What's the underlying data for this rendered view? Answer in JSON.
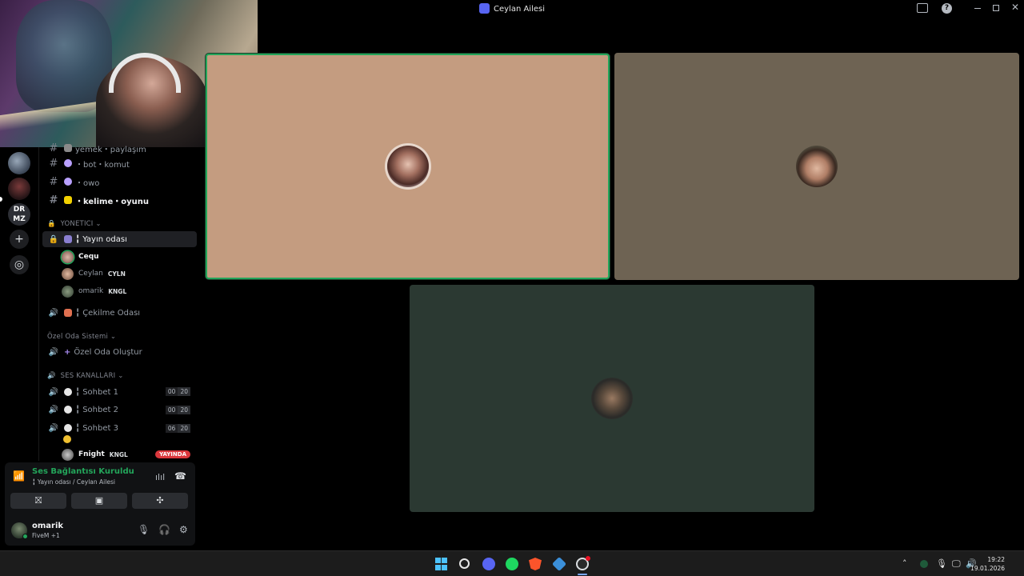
{
  "window": {
    "title": "Ceylan Ailesi"
  },
  "channels": {
    "text": [
      {
        "name": "yemek・paylaşım",
        "emoji_color": "#8a8a8a"
      },
      {
        "name": "・bot・komut",
        "emoji_color": "#b9a0ff"
      },
      {
        "name": "・owo",
        "emoji_color": "#b9a0ff"
      },
      {
        "name": "・kelime・oyunu",
        "emoji_color": "#f2d100"
      }
    ],
    "category_admin": "YONETICI",
    "stream_channel": "╏ Yayın odası",
    "stream_users": [
      {
        "name": "Cequ",
        "tag": ""
      },
      {
        "name": "Ceylan",
        "tag": "CYLN"
      },
      {
        "name": "omarik",
        "tag": "KNGL"
      }
    ],
    "cekilme": "╏ Çekilme Odası",
    "category_private": "Özel Oda Sistemi",
    "create_room": "Özel Oda Oluştur",
    "category_voice": "SES KANALLARI",
    "voice_channels": [
      {
        "name": "╏ Sohbet 1",
        "count": "00",
        "limit": "20"
      },
      {
        "name": "╏ Sohbet 2",
        "count": "00",
        "limit": "20"
      },
      {
        "name": "╏ Sohbet 3",
        "count": "06",
        "limit": "20"
      }
    ],
    "live_user": {
      "name": "Fnight",
      "tag": "KNGL",
      "badge": "YAYINDA"
    }
  },
  "voice_panel": {
    "status": "Ses Bağlantısı Kuruldu",
    "subtitle": "╏ Yayın odası / Ceylan Ailesi"
  },
  "user": {
    "name": "omarik",
    "activity": "FiveM +1"
  },
  "clock": {
    "time": "19:22",
    "date": "19.01.2026"
  },
  "colors": {
    "accent": "#5865f2",
    "online": "#23a55a",
    "live": "#da373c"
  }
}
